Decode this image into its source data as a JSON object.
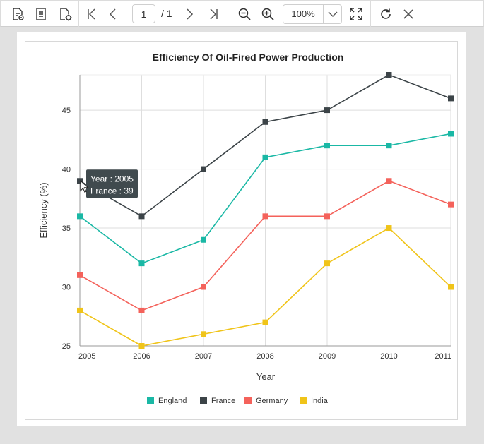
{
  "toolbar": {
    "page_current": "1",
    "page_total": "/ 1",
    "zoom": "100%"
  },
  "chart_data": {
    "type": "line",
    "title": "Efficiency Of Oil-Fired Power Production",
    "xlabel": "Year",
    "ylabel": "Efficiency (%)",
    "x": [
      2005,
      2006,
      2007,
      2008,
      2009,
      2010,
      2011
    ],
    "x_ticks": [
      "2005",
      "2006",
      "2007",
      "2008",
      "2009",
      "2010",
      "2011"
    ],
    "ylim": [
      25,
      48
    ],
    "y_ticks": [
      25,
      30,
      35,
      40,
      45
    ],
    "grid": true,
    "legend": "bottom",
    "series": [
      {
        "name": "England",
        "color": "#1ab8a5",
        "values": [
          36,
          32,
          34,
          41,
          42,
          42,
          43
        ]
      },
      {
        "name": "France",
        "color": "#3c4448",
        "values": [
          39,
          36,
          40,
          44,
          45,
          48,
          46
        ]
      },
      {
        "name": "Germany",
        "color": "#f4625b",
        "values": [
          31,
          28,
          30,
          36,
          36,
          39,
          37
        ]
      },
      {
        "name": "India",
        "color": "#f0c419",
        "values": [
          28,
          25,
          26,
          27,
          32,
          35,
          30
        ]
      }
    ],
    "tooltip": {
      "line1": "Year : 2005",
      "line2": "France : 39",
      "series": "France",
      "x": 2005
    }
  }
}
